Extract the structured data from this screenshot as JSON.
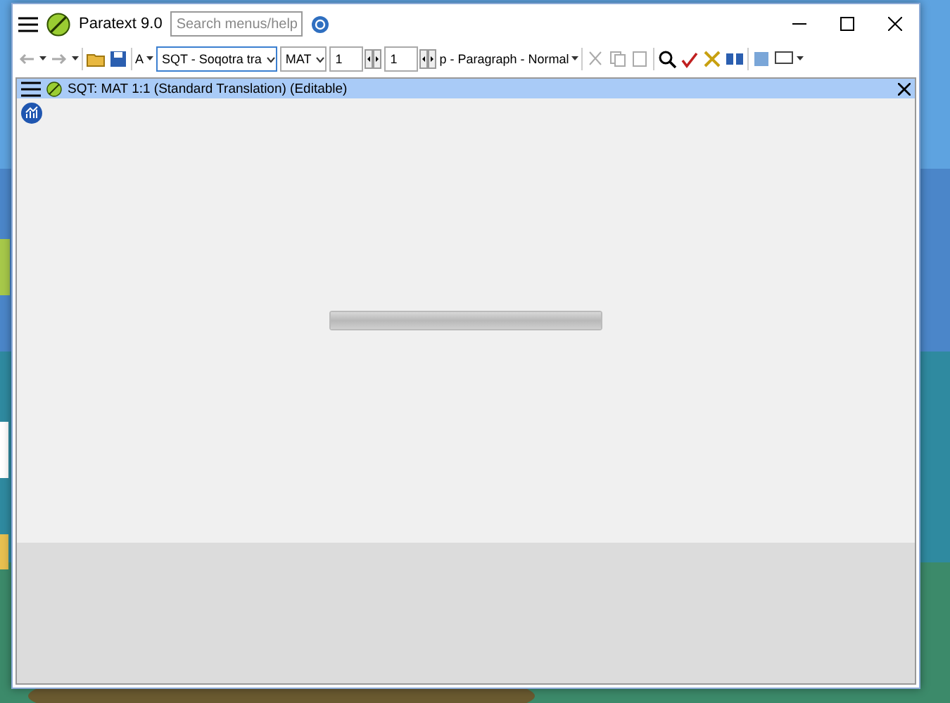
{
  "window": {
    "title": "Paratext 9.0",
    "search": {
      "placeholder": "Search menus/help"
    }
  },
  "toolbar": {
    "project": "SQT  - Soqotra tra",
    "book": "MAT",
    "chapter": "1",
    "verse": "1",
    "style": "p - Paragraph - Normal",
    "font_button": "A"
  },
  "pane": {
    "title": "SQT: MAT 1:1 (Standard Translation) (Editable)",
    "progress": {
      "level": 1
    }
  }
}
